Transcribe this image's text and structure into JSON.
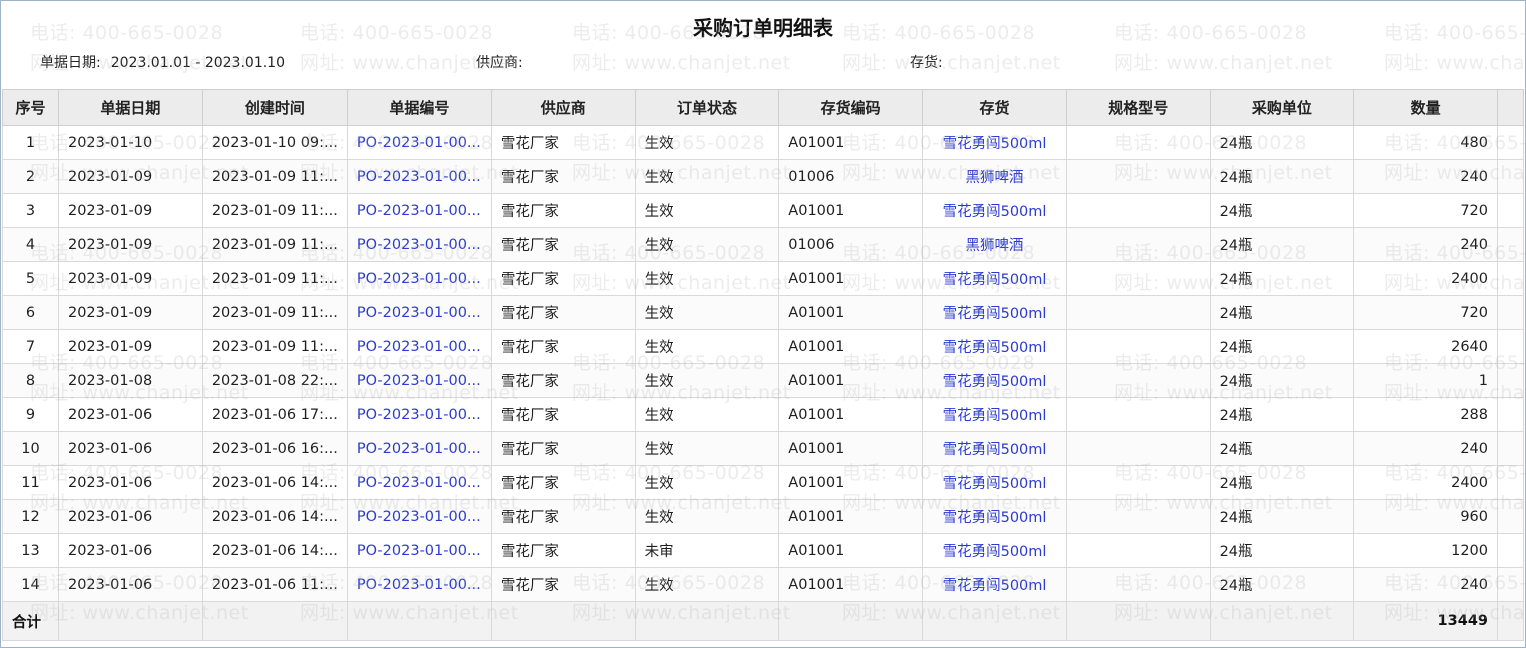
{
  "report": {
    "title": "采购订单明细表",
    "filters": {
      "date_label": "单据日期:",
      "date_value": "2023.01.01 - 2023.01.10",
      "supplier_label": "供应商:",
      "supplier_value": "",
      "stock_label": "存货:",
      "stock_value": ""
    }
  },
  "watermark": {
    "phone": "电话: 400-665-0028",
    "site": "网址: www.chanjet.net"
  },
  "table": {
    "columns": [
      "序号",
      "单据日期",
      "创建时间",
      "单据编号",
      "供应商",
      "订单状态",
      "存货编码",
      "存货",
      "规格型号",
      "采购单位",
      "数量"
    ],
    "rows": [
      {
        "no": "1",
        "date": "2023-01-10",
        "created": "2023-01-10 09:...",
        "code": "PO-2023-01-00...",
        "supplier": "雪花厂家",
        "status": "生效",
        "item_code": "A01001",
        "item": "雪花勇闯500ml",
        "spec": "",
        "unit": "24瓶",
        "qty": "480"
      },
      {
        "no": "2",
        "date": "2023-01-09",
        "created": "2023-01-09 11:...",
        "code": "PO-2023-01-00...",
        "supplier": "雪花厂家",
        "status": "生效",
        "item_code": "01006",
        "item": "黑狮啤酒",
        "spec": "",
        "unit": "24瓶",
        "qty": "240"
      },
      {
        "no": "3",
        "date": "2023-01-09",
        "created": "2023-01-09 11:...",
        "code": "PO-2023-01-00...",
        "supplier": "雪花厂家",
        "status": "生效",
        "item_code": "A01001",
        "item": "雪花勇闯500ml",
        "spec": "",
        "unit": "24瓶",
        "qty": "720"
      },
      {
        "no": "4",
        "date": "2023-01-09",
        "created": "2023-01-09 11:...",
        "code": "PO-2023-01-00...",
        "supplier": "雪花厂家",
        "status": "生效",
        "item_code": "01006",
        "item": "黑狮啤酒",
        "spec": "",
        "unit": "24瓶",
        "qty": "240"
      },
      {
        "no": "5",
        "date": "2023-01-09",
        "created": "2023-01-09 11:...",
        "code": "PO-2023-01-00...",
        "supplier": "雪花厂家",
        "status": "生效",
        "item_code": "A01001",
        "item": "雪花勇闯500ml",
        "spec": "",
        "unit": "24瓶",
        "qty": "2400"
      },
      {
        "no": "6",
        "date": "2023-01-09",
        "created": "2023-01-09 11:...",
        "code": "PO-2023-01-00...",
        "supplier": "雪花厂家",
        "status": "生效",
        "item_code": "A01001",
        "item": "雪花勇闯500ml",
        "spec": "",
        "unit": "24瓶",
        "qty": "720"
      },
      {
        "no": "7",
        "date": "2023-01-09",
        "created": "2023-01-09 11:...",
        "code": "PO-2023-01-00...",
        "supplier": "雪花厂家",
        "status": "生效",
        "item_code": "A01001",
        "item": "雪花勇闯500ml",
        "spec": "",
        "unit": "24瓶",
        "qty": "2640"
      },
      {
        "no": "8",
        "date": "2023-01-08",
        "created": "2023-01-08 22:...",
        "code": "PO-2023-01-00...",
        "supplier": "雪花厂家",
        "status": "生效",
        "item_code": "A01001",
        "item": "雪花勇闯500ml",
        "spec": "",
        "unit": "24瓶",
        "qty": "1"
      },
      {
        "no": "9",
        "date": "2023-01-06",
        "created": "2023-01-06 17:...",
        "code": "PO-2023-01-00...",
        "supplier": "雪花厂家",
        "status": "生效",
        "item_code": "A01001",
        "item": "雪花勇闯500ml",
        "spec": "",
        "unit": "24瓶",
        "qty": "288"
      },
      {
        "no": "10",
        "date": "2023-01-06",
        "created": "2023-01-06 16:...",
        "code": "PO-2023-01-00...",
        "supplier": "雪花厂家",
        "status": "生效",
        "item_code": "A01001",
        "item": "雪花勇闯500ml",
        "spec": "",
        "unit": "24瓶",
        "qty": "240"
      },
      {
        "no": "11",
        "date": "2023-01-06",
        "created": "2023-01-06 14:...",
        "code": "PO-2023-01-00...",
        "supplier": "雪花厂家",
        "status": "生效",
        "item_code": "A01001",
        "item": "雪花勇闯500ml",
        "spec": "",
        "unit": "24瓶",
        "qty": "2400"
      },
      {
        "no": "12",
        "date": "2023-01-06",
        "created": "2023-01-06 14:...",
        "code": "PO-2023-01-00...",
        "supplier": "雪花厂家",
        "status": "生效",
        "item_code": "A01001",
        "item": "雪花勇闯500ml",
        "spec": "",
        "unit": "24瓶",
        "qty": "960"
      },
      {
        "no": "13",
        "date": "2023-01-06",
        "created": "2023-01-06 14:...",
        "code": "PO-2023-01-00...",
        "supplier": "雪花厂家",
        "status": "未审",
        "item_code": "A01001",
        "item": "雪花勇闯500ml",
        "spec": "",
        "unit": "24瓶",
        "qty": "1200"
      },
      {
        "no": "14",
        "date": "2023-01-06",
        "created": "2023-01-06 11:...",
        "code": "PO-2023-01-00...",
        "supplier": "雪花厂家",
        "status": "生效",
        "item_code": "A01001",
        "item": "雪花勇闯500ml",
        "spec": "",
        "unit": "24瓶",
        "qty": "240"
      }
    ],
    "total": {
      "label": "合计",
      "qty": "13449"
    }
  }
}
